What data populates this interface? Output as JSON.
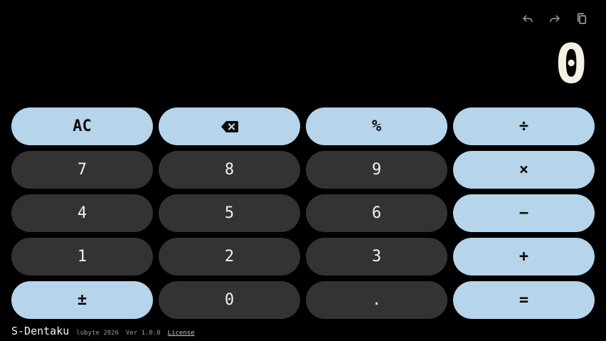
{
  "app": {
    "name": "S-Dentaku",
    "author": "lubyte 2026",
    "version": "Ver 1.0.0",
    "license_label": "License"
  },
  "toolbar": {
    "undo_icon": "undo-icon",
    "redo_icon": "redo-icon",
    "copy_icon": "copy-icon"
  },
  "display": {
    "value": "0"
  },
  "keys": {
    "clear": "AC",
    "backspace_icon": "backspace-icon",
    "percent": "%",
    "divide": "÷",
    "seven": "7",
    "eight": "8",
    "nine": "9",
    "multiply": "×",
    "four": "4",
    "five": "5",
    "six": "6",
    "subtract": "−",
    "one": "1",
    "two": "2",
    "three": "3",
    "add": "+",
    "negate": "±",
    "zero": "0",
    "decimal": ".",
    "equals": "="
  },
  "colors": {
    "background": "#000000",
    "operator_key": "#b6d4ea",
    "digit_key": "#333333",
    "display_text": "#f5f1e2"
  }
}
